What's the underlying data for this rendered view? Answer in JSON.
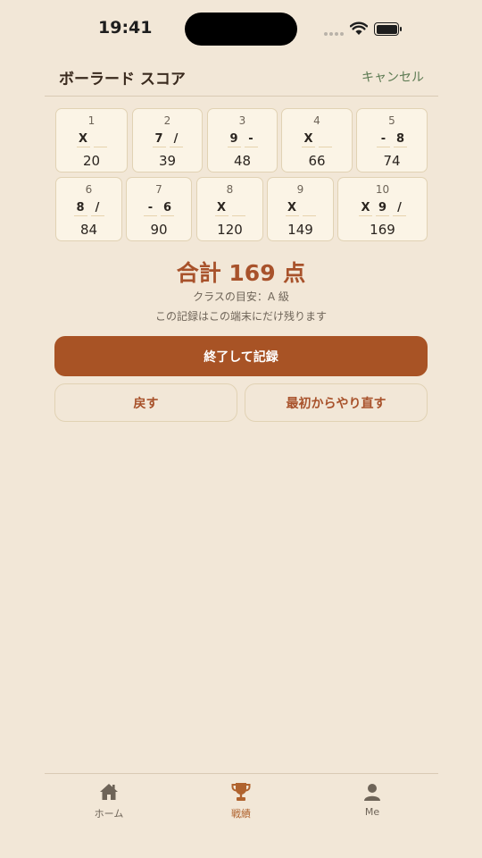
{
  "status_bar": {
    "time": "19:41"
  },
  "header": {
    "title": "ボーラード スコア",
    "cancel_label": "キャンセル"
  },
  "frames": [
    {
      "number": "1",
      "rolls": [
        "X",
        ""
      ],
      "score": "20"
    },
    {
      "number": "2",
      "rolls": [
        "7",
        "/"
      ],
      "score": "39"
    },
    {
      "number": "3",
      "rolls": [
        "9",
        "-"
      ],
      "score": "48"
    },
    {
      "number": "4",
      "rolls": [
        "X",
        ""
      ],
      "score": "66"
    },
    {
      "number": "5",
      "rolls": [
        "-",
        "8"
      ],
      "score": "74"
    },
    {
      "number": "6",
      "rolls": [
        "8",
        "/"
      ],
      "score": "84"
    },
    {
      "number": "7",
      "rolls": [
        "-",
        "6"
      ],
      "score": "90"
    },
    {
      "number": "8",
      "rolls": [
        "X",
        ""
      ],
      "score": "120"
    },
    {
      "number": "9",
      "rolls": [
        "X",
        ""
      ],
      "score": "149"
    },
    {
      "number": "10",
      "rolls": [
        "X",
        "9",
        "/"
      ],
      "score": "169"
    }
  ],
  "summary": {
    "total_text": "合計 169 点",
    "class_guide": "クラスの目安：A 級",
    "local_note": "この記録はこの端末にだけ残ります"
  },
  "buttons": {
    "finish": "終了して記録",
    "undo": "戻す",
    "restart": "最初からやり直す"
  },
  "tabs": [
    {
      "label": "ホーム",
      "icon": "house-icon",
      "active": false
    },
    {
      "label": "戦績",
      "icon": "trophy-icon",
      "active": true
    },
    {
      "label": "Me",
      "icon": "person-icon",
      "active": false
    }
  ],
  "colors": {
    "background": "#f2e7d7",
    "accent": "#a85325",
    "cancel": "#5c7a52",
    "tab_active": "#b0632e"
  }
}
